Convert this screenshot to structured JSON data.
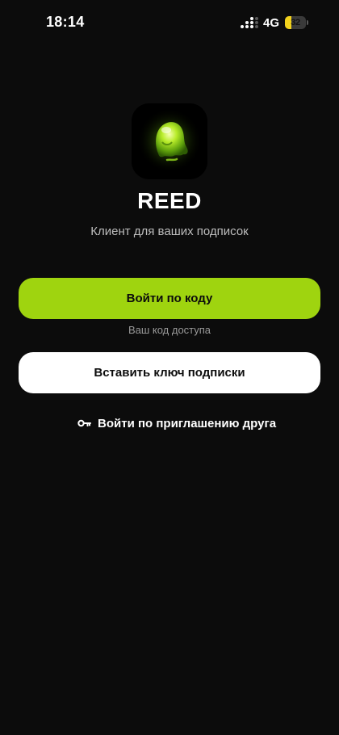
{
  "status_bar": {
    "time": "18:14",
    "network": "4G",
    "battery_level": "32",
    "battery_fraction": 0.32,
    "battery_color": "#f2d21c"
  },
  "app": {
    "logo_icon": "glowing-ghost-icon",
    "name": "REED",
    "subtitle": "Клиент для ваших подписок"
  },
  "actions": {
    "login_by_code": "Войти по коду",
    "login_by_code_hint": "Ваш код доступа",
    "paste_key": "Вставить ключ подписки",
    "invite": {
      "icon": "key-icon",
      "label": "Войти по приглашению друга"
    }
  },
  "colors": {
    "background": "#0c0c0c",
    "accent": "#9fd40f",
    "secondary_button": "#ffffff",
    "subtitle_text": "#bdbdbd",
    "hint_text": "#9a9a9a"
  }
}
